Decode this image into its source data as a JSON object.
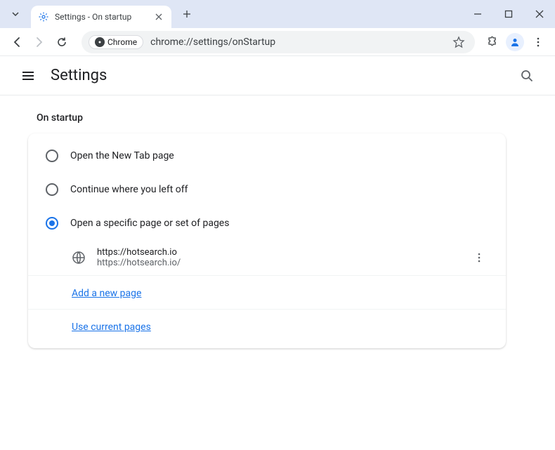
{
  "window": {
    "tab_title": "Settings - On startup"
  },
  "toolbar": {
    "chip_label": "Chrome",
    "url": "chrome://settings/onStartup"
  },
  "header": {
    "title": "Settings"
  },
  "startup": {
    "section_title": "On startup",
    "options": [
      {
        "label": "Open the New Tab page"
      },
      {
        "label": "Continue where you left off"
      },
      {
        "label": "Open a specific page or set of pages"
      }
    ],
    "pages": [
      {
        "title": "https://hotsearch.io",
        "url": "https://hotsearch.io/"
      }
    ],
    "add_page_label": "Add a new page",
    "use_current_label": "Use current pages"
  }
}
